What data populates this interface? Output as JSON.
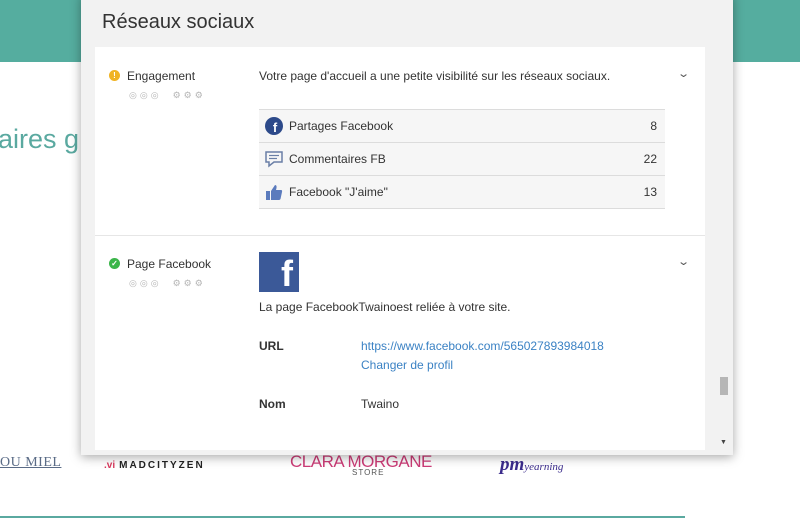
{
  "background": {
    "heading_fragment": "aires g",
    "logos": {
      "miel": "OU MIEL",
      "madcity_prefix": ".vi",
      "madcity": "MADCITYZEN",
      "clara": "CLARA MORGANE",
      "clara_store": "STORE",
      "pm": "pm",
      "pm_suffix": "yearning"
    }
  },
  "modal": {
    "title": "Réseaux sociaux",
    "sections": {
      "engagement": {
        "title": "Engagement",
        "status": "warning",
        "rating_circles": "◎◎◎",
        "rating_gears": "⚙⚙⚙",
        "description": "Votre page d'accueil a une petite visibilité sur les réseaux sociaux.",
        "stats": [
          {
            "label": "Partages Facebook",
            "value": "8",
            "icon": "facebook-round-icon"
          },
          {
            "label": "Commentaires FB",
            "value": "22",
            "icon": "comment-icon"
          },
          {
            "label": "Facebook \"J'aime\"",
            "value": "13",
            "icon": "thumbs-up-icon"
          }
        ]
      },
      "facebook_page": {
        "title": "Page Facebook",
        "status": "ok",
        "rating_circles": "◎◎◎",
        "rating_gears": "⚙⚙⚙",
        "logo_letter": "f",
        "linked_text": "La page FacebookTwainoest reliée à votre site.",
        "url_label": "URL",
        "url_value": "https://www.facebook.com/565027893984018",
        "change_profile": "Changer de profil",
        "name_label": "Nom",
        "name_value": "Twaino"
      }
    }
  },
  "colors": {
    "band": "#55ad9f",
    "accent_link": "#3b82c4",
    "facebook": "#3b5998",
    "warning": "#f0b323",
    "ok": "#3bb54a"
  }
}
